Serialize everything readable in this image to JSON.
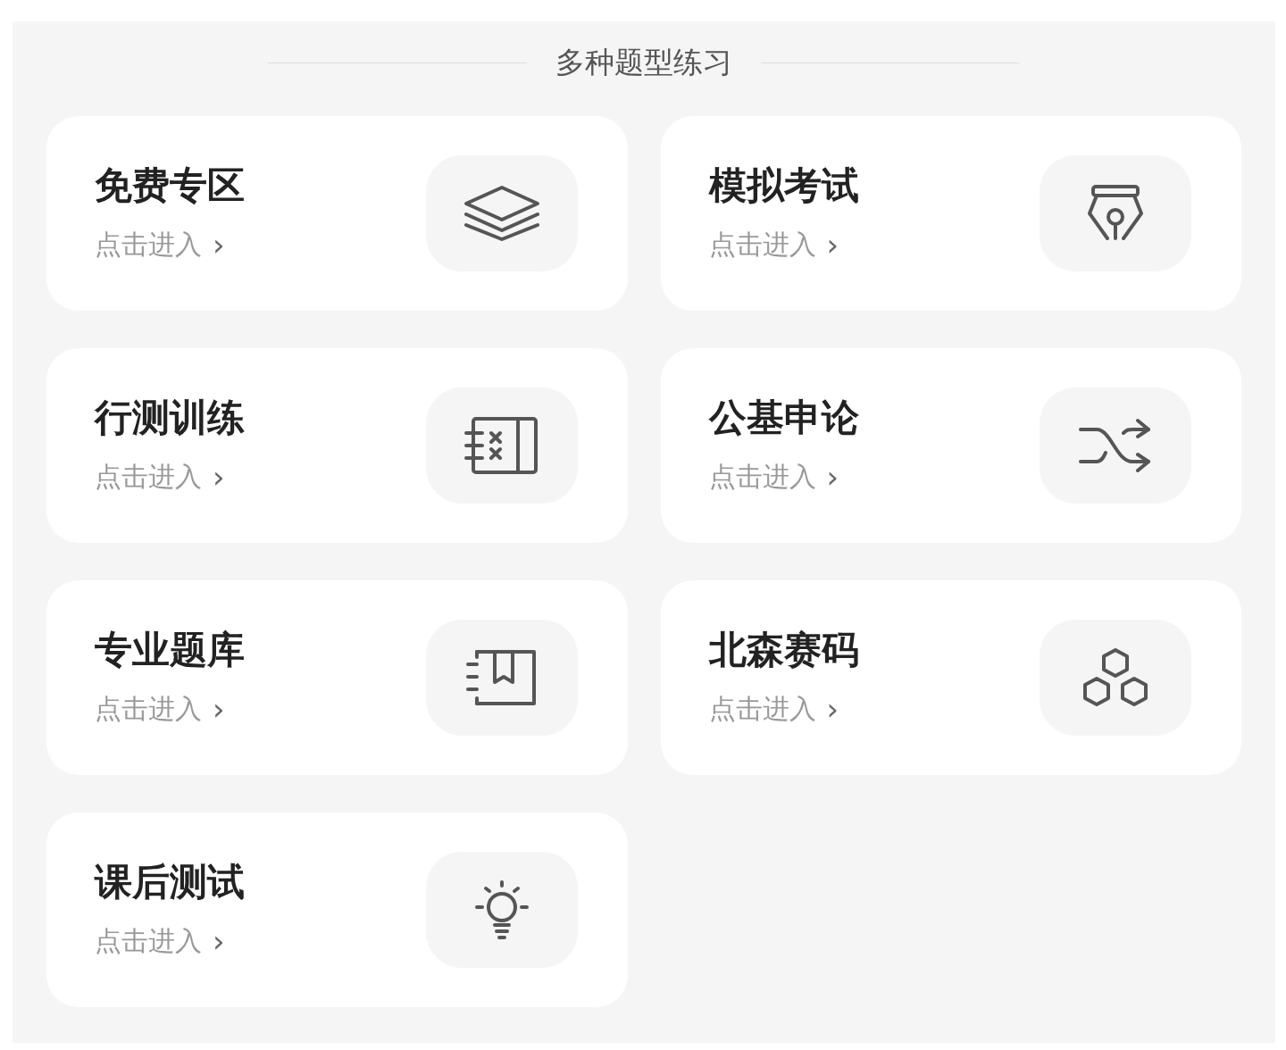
{
  "section_title": "多种题型练习",
  "cards": [
    {
      "title": "免费专区",
      "link": "点击进入",
      "arrow": "›",
      "kind": "layers"
    },
    {
      "title": "模拟考试",
      "link": "点击进入",
      "arrow": "›",
      "kind": "pen"
    },
    {
      "title": "行测训练",
      "link": "点击进入",
      "arrow": "›",
      "kind": "notebook"
    },
    {
      "title": "公基申论",
      "link": "点击进入",
      "arrow": "›",
      "kind": "shuffle"
    },
    {
      "title": "专业题库",
      "link": "点击进入",
      "arrow": "›",
      "kind": "bookmark"
    },
    {
      "title": "北森赛码",
      "link": "点击进入",
      "arrow": "›",
      "kind": "hexagons"
    },
    {
      "title": "课后测试",
      "link": "点击进入",
      "arrow": "›",
      "kind": "bulb"
    }
  ]
}
